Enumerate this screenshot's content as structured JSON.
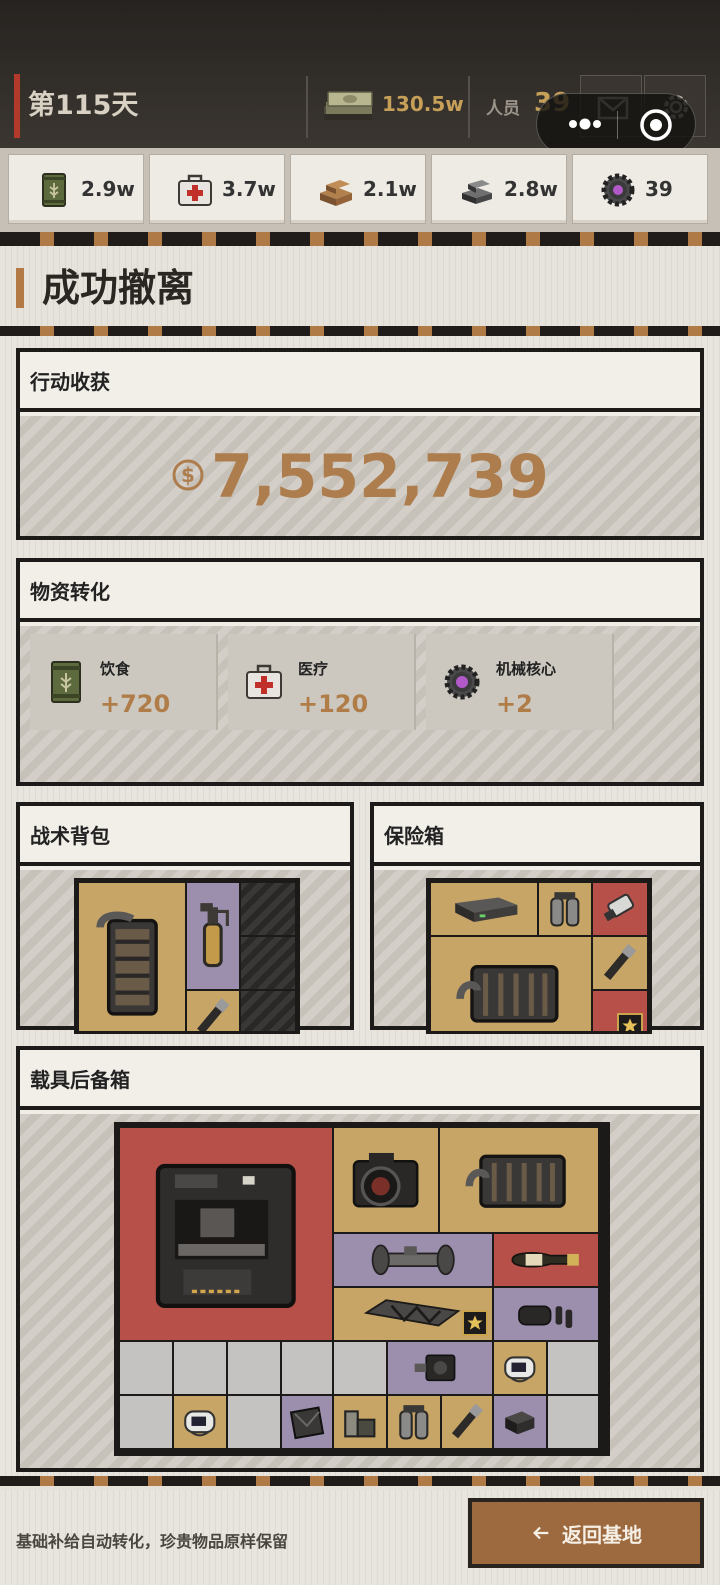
{
  "header": {
    "day_label": "第115天",
    "money": "130.5w",
    "staff_label": "人员",
    "staff_value": "39"
  },
  "resources": [
    {
      "name": "food",
      "icon": "food-can-icon",
      "value": "2.9w"
    },
    {
      "name": "medical",
      "icon": "medkit-icon",
      "value": "3.7w"
    },
    {
      "name": "wood",
      "icon": "wood-planks-icon",
      "value": "2.1w"
    },
    {
      "name": "steel",
      "icon": "steel-ingot-icon",
      "value": "2.8w"
    },
    {
      "name": "core",
      "icon": "mech-core-icon",
      "value": "39"
    }
  ],
  "page_title": "成功撤离",
  "earnings": {
    "title": "行动收获",
    "amount": "7,552,739"
  },
  "conversion": {
    "title": "物资转化",
    "items": [
      {
        "label": "饮食",
        "value": "+720",
        "icon": "food-can-icon"
      },
      {
        "label": "医疗",
        "value": "+120",
        "icon": "medkit-icon"
      },
      {
        "label": "机械核心",
        "value": "+2",
        "icon": "mech-core-icon"
      }
    ]
  },
  "backpack": {
    "title": "战术背包"
  },
  "safebox": {
    "title": "保险箱"
  },
  "trunk": {
    "title": "载具后备箱"
  },
  "footer": {
    "note": "基础补给自动转化，珍贵物品原样保留",
    "back_label": "返回基地"
  },
  "colors": {
    "accent_gold": "#c69f58",
    "accent_copper": "#ad7d4d",
    "day_bar": "#b33a2a",
    "button": "#9c6a3e"
  }
}
